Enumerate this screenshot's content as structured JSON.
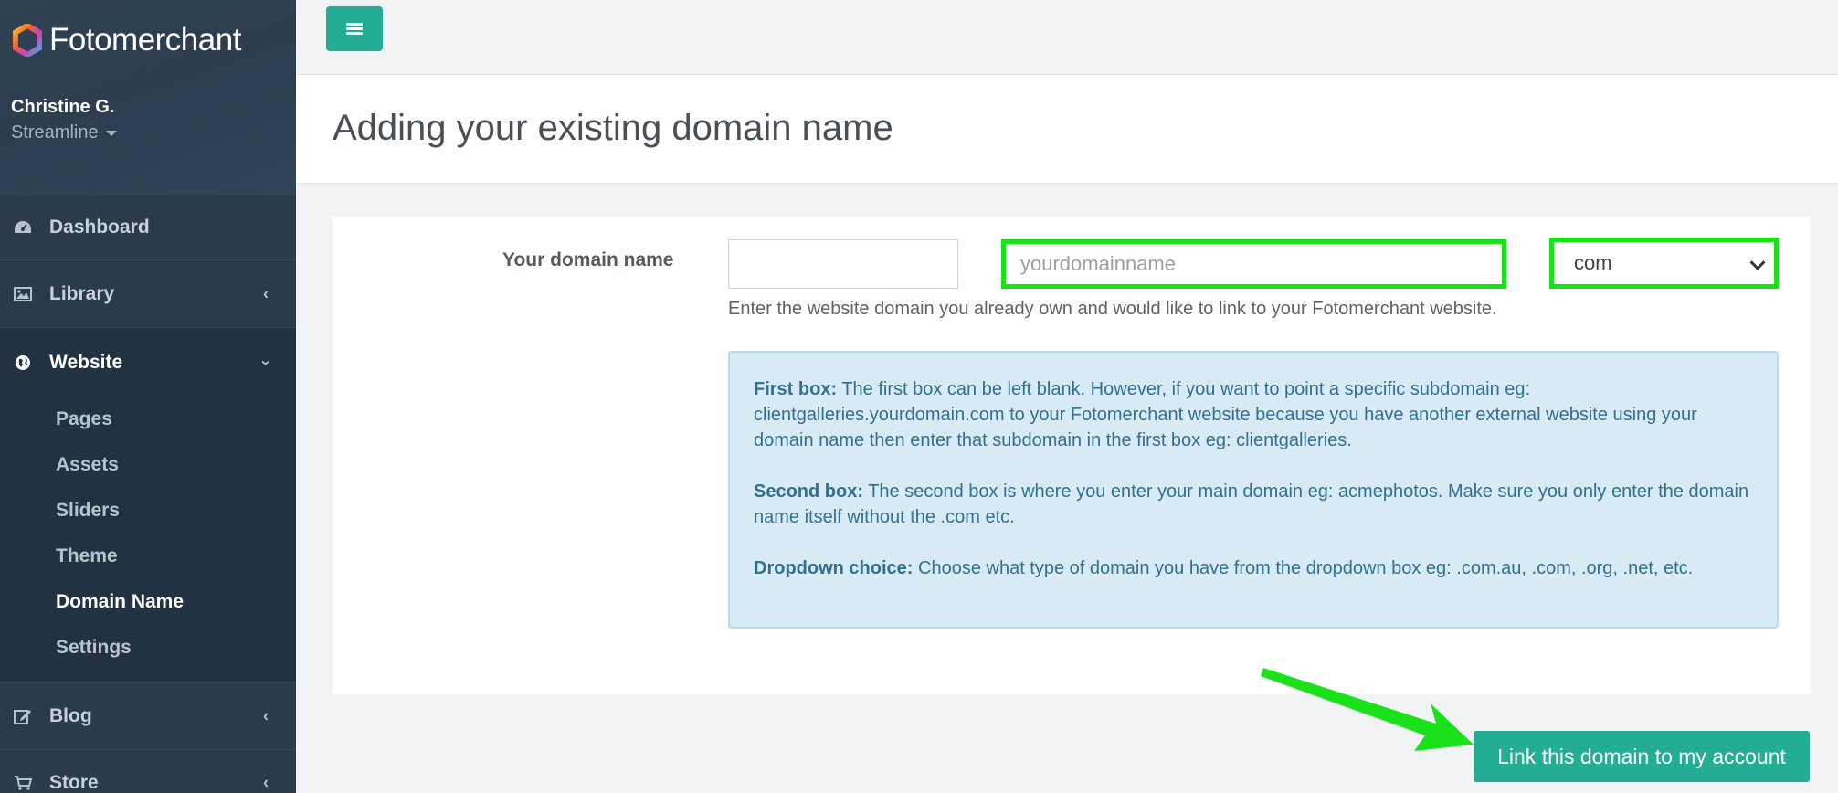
{
  "brand": {
    "name": "Fotomerchant",
    "accent": "#23ad94",
    "sidebar_bg": "#2a3b4c",
    "highlight": "#19e11a"
  },
  "user": {
    "name": "Christine G.",
    "plan": "Streamline"
  },
  "sidebar": {
    "items": [
      {
        "label": "Dashboard",
        "icon": "dashboard-icon"
      },
      {
        "label": "Library",
        "icon": "image-icon"
      },
      {
        "label": "Website",
        "icon": "globe-icon"
      },
      {
        "label": "Blog",
        "icon": "edit-icon"
      },
      {
        "label": "Store",
        "icon": "cart-icon"
      }
    ],
    "website_sub": [
      "Pages",
      "Assets",
      "Sliders",
      "Theme",
      "Domain Name",
      "Settings"
    ]
  },
  "page": {
    "title": "Adding your existing domain name"
  },
  "form": {
    "label": "Your domain name",
    "subdomain_value": "",
    "domain_placeholder": "yourdomainname",
    "tld_selected": "com",
    "help": "Enter the website domain you already own and would like to link to your Fotomerchant website."
  },
  "info": {
    "first_title": "First box:",
    "first_text": " The first box can be left blank. However, if you want to point a specific subdomain eg: clientgalleries.yourdomain.com to your Fotomerchant website because you have another external website using your domain name then enter that subdomain in the first box eg: clientgalleries.",
    "second_title": "Second box:",
    "second_text": " The second box is where you enter your main domain eg: acmephotos. Make sure you only enter the domain name itself without the .com etc.",
    "dropdown_title": "Dropdown choice:",
    "dropdown_text": " Choose what type of domain you have from the dropdown box eg: .com.au, .com, .org, .net, etc."
  },
  "actions": {
    "link_label": "Link this domain to my account"
  }
}
